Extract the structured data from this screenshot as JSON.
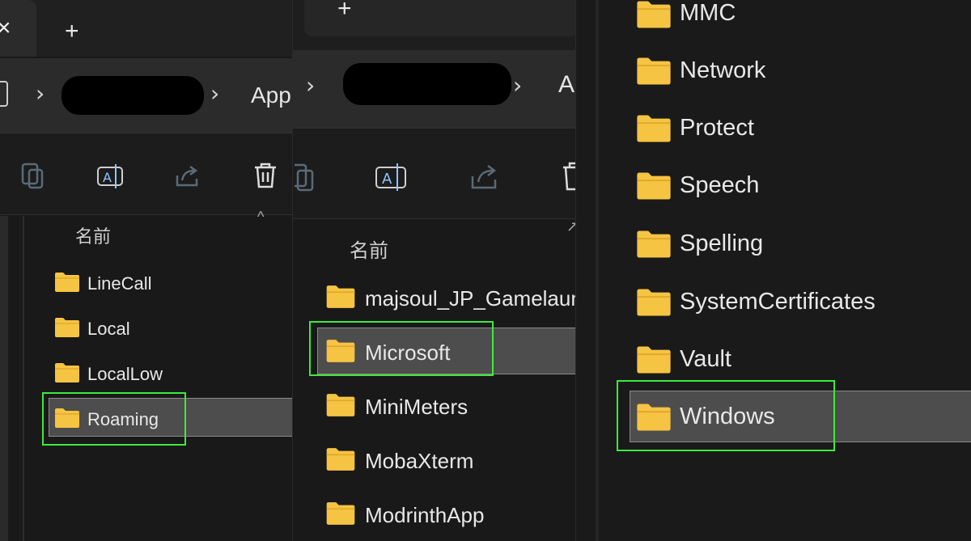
{
  "panel1": {
    "tab_close": "×",
    "new_tab": "+",
    "crumb_sep": "›",
    "crumb_last": "App",
    "column_name": "名前",
    "sort_caret": "^",
    "items": [
      "LineCall",
      "Local",
      "LocalLow",
      "Roaming"
    ],
    "selected": "Roaming"
  },
  "panel2": {
    "new_tab": "+",
    "crumb_sep": "›",
    "crumb_last": "A",
    "column_name": "名前",
    "items": [
      "majsoul_JP_Gamelaun",
      "Microsoft",
      "MiniMeters",
      "MobaXterm",
      "ModrinthApp"
    ],
    "selected": "Microsoft"
  },
  "panel3": {
    "items": [
      "MMC",
      "Network",
      "Protect",
      "Speech",
      "Spelling",
      "SystemCertificates",
      "Vault",
      "Windows"
    ],
    "selected": "Windows"
  },
  "icons": {
    "folder": "folder-icon",
    "copy": "copy-icon",
    "rename": "rename-icon",
    "share": "share-icon",
    "delete": "delete-icon",
    "highlight": "#3dea3d",
    "folder_color": "#f6c443"
  }
}
